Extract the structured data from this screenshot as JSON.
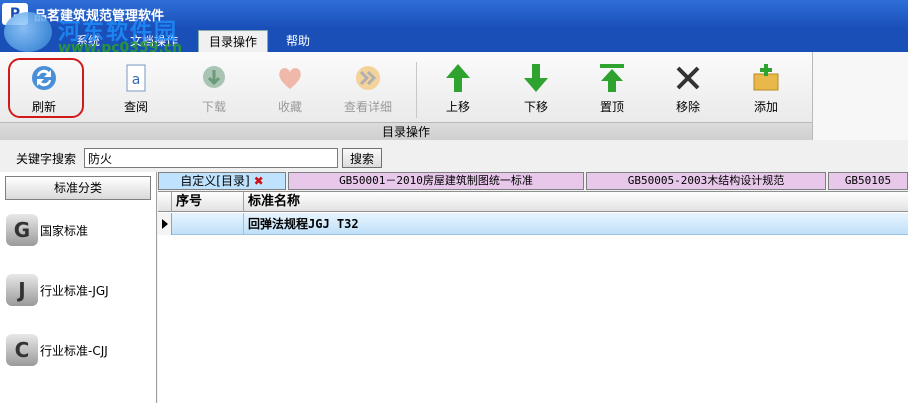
{
  "window": {
    "title": "品茗建筑规范管理软件",
    "logo_letter": "P"
  },
  "watermark": {
    "text": "河东软件园",
    "url": "www.pc0359.cn"
  },
  "menu": {
    "items": [
      "系统",
      "文档操作",
      "目录操作",
      "帮助"
    ],
    "active_index": 2
  },
  "ribbon": {
    "group_label": "目录操作",
    "buttons": [
      {
        "label": "刷新",
        "icon": "refresh-icon",
        "enabled": true,
        "highlighted": true
      },
      {
        "label": "查阅",
        "icon": "document-icon",
        "enabled": true
      },
      {
        "label": "下载",
        "icon": "download-globe-icon",
        "enabled": false
      },
      {
        "label": "收藏",
        "icon": "heart-icon",
        "enabled": false
      },
      {
        "label": "查看详细",
        "icon": "forward-arrows-icon",
        "enabled": false
      },
      {
        "label": "上移",
        "icon": "arrow-up-icon",
        "enabled": true
      },
      {
        "label": "下移",
        "icon": "arrow-down-icon",
        "enabled": true
      },
      {
        "label": "置顶",
        "icon": "arrow-to-top-icon",
        "enabled": true
      },
      {
        "label": "移除",
        "icon": "x-remove-icon",
        "enabled": true
      },
      {
        "label": "添加",
        "icon": "add-folder-icon",
        "enabled": true
      }
    ],
    "highlight_color": "#d21a1a"
  },
  "search": {
    "label": "关键字搜索",
    "value": "防火",
    "button_label": "搜索"
  },
  "sidebar": {
    "header": "标准分类",
    "items": [
      {
        "label": "国家标准",
        "letter": "G"
      },
      {
        "label": "行业标准-JGJ",
        "letter": "J"
      },
      {
        "label": "行业标准-CJJ",
        "letter": "C"
      }
    ]
  },
  "tabs": [
    {
      "label": "自定义[目录]",
      "active": true,
      "closable": true
    },
    {
      "label": "GB50001－2010房屋建筑制图统一标准",
      "active": false
    },
    {
      "label": "GB50005-2003木结构设计规范",
      "active": false
    },
    {
      "label": "GB50105",
      "active": false
    }
  ],
  "grid": {
    "columns": [
      "序号",
      "标准名称"
    ],
    "rows": [
      {
        "index": "",
        "name": "回弹法规程JGJ T32"
      }
    ]
  },
  "colors": {
    "title_blue": "#1a4fb8",
    "tab_inactive": "#e7c8ea",
    "tab_active": "#bfe3ff",
    "row_selected": "#bfe0f8"
  }
}
